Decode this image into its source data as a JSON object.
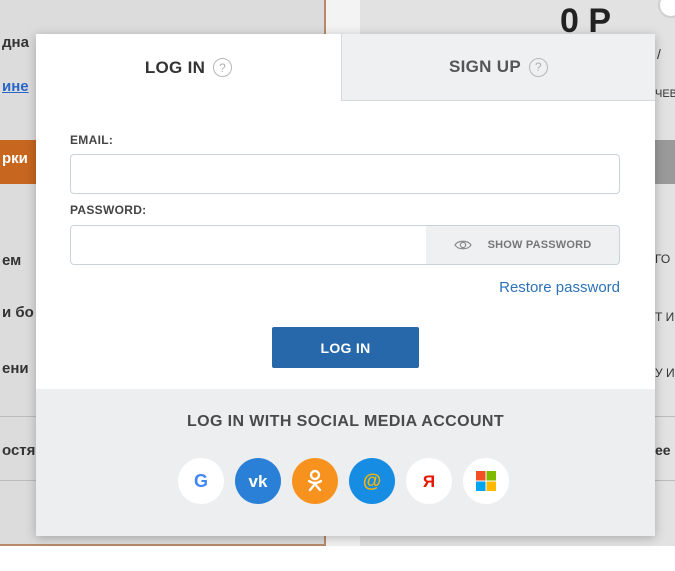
{
  "background": {
    "left_snippets": [
      "дна",
      "ине",
      "ем",
      "и бо",
      "ени",
      "остя"
    ],
    "orange_snippet": "рки",
    "right_snippets": [
      "ЧЕВ",
      "/",
      "ГО",
      "Т И",
      "У И",
      "ее"
    ],
    "price": "0 Р"
  },
  "modal": {
    "tabs": [
      {
        "label": "LOG IN",
        "help": "?"
      },
      {
        "label": "SIGN UP",
        "help": "?"
      }
    ],
    "email_label": "EMAIL:",
    "email_value": "",
    "password_label": "PASSWORD:",
    "password_value": "",
    "show_password_label": "SHOW PASSWORD",
    "restore_label": "Restore password",
    "login_button_label": "LOG IN",
    "social_title": "LOG IN WITH SOCIAL MEDIA ACCOUNT",
    "social": [
      {
        "name": "google",
        "icon": "google-icon",
        "glyph": "G"
      },
      {
        "name": "vk",
        "icon": "vk-icon",
        "glyph": "vk"
      },
      {
        "name": "odnoklassniki",
        "icon": "ok-icon",
        "glyph": "ok"
      },
      {
        "name": "mail",
        "icon": "mail-at-icon",
        "glyph": "@"
      },
      {
        "name": "yandex",
        "icon": "yandex-icon",
        "glyph": "Я"
      },
      {
        "name": "microsoft",
        "icon": "microsoft-icon",
        "glyph": ""
      }
    ]
  },
  "colors": {
    "primary": "#2768ab",
    "link": "#2d72b8",
    "social_bg": "#eceef0"
  }
}
